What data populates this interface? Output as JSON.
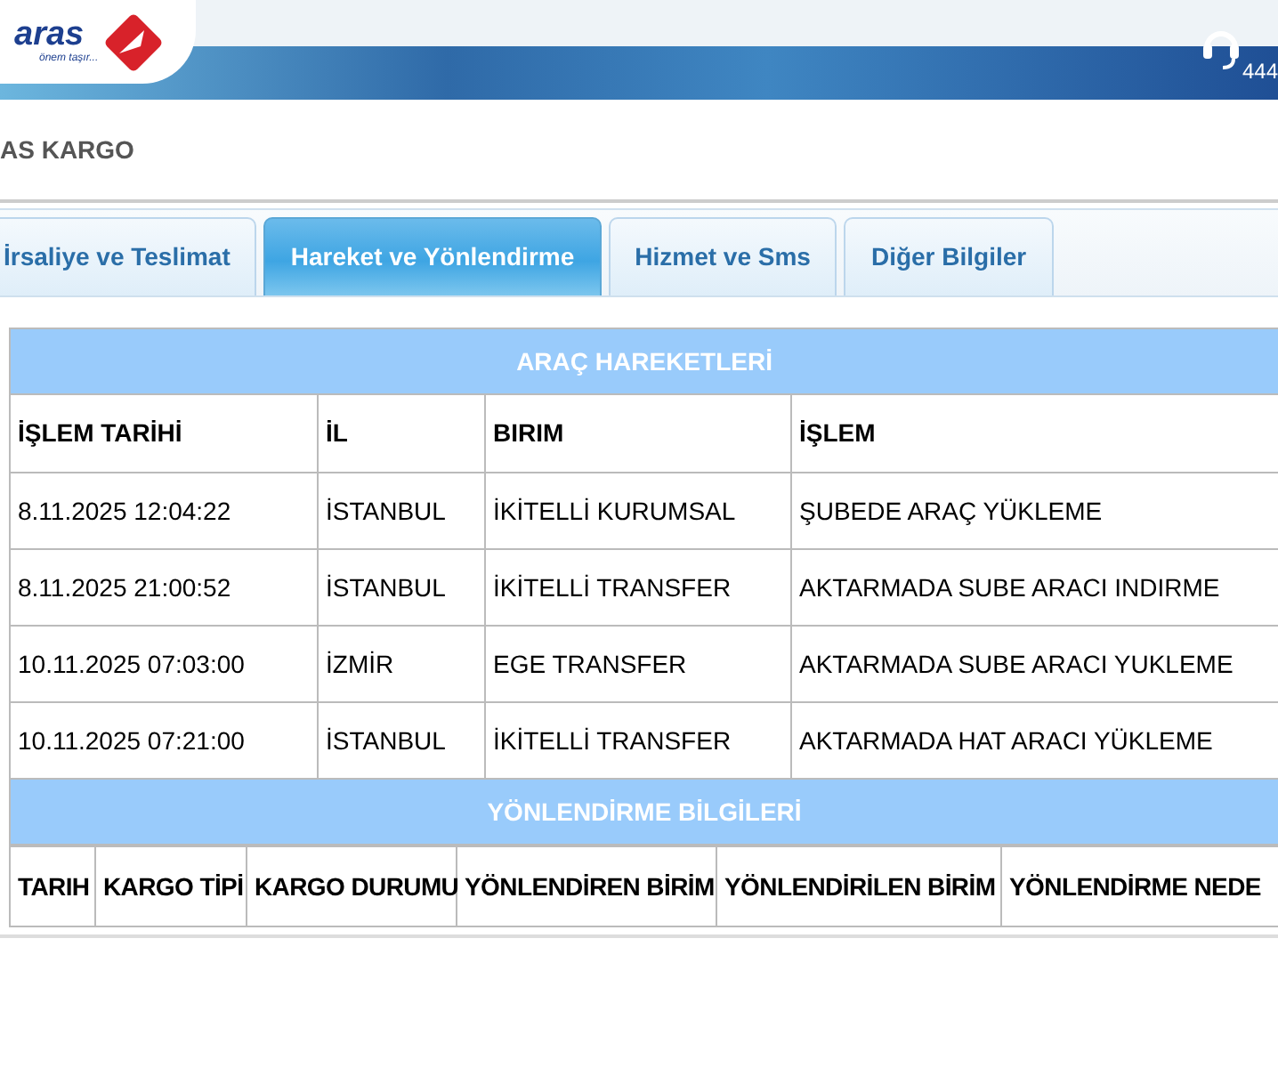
{
  "header": {
    "logo_text": "aras",
    "tagline": "önem taşır...",
    "phone": "444"
  },
  "company": "AS KARGO",
  "tabs": [
    {
      "label": "İrsaliye ve Teslimat",
      "selected": false
    },
    {
      "label": "Hareket ve Yönlendirme",
      "selected": true
    },
    {
      "label": "Hizmet ve Sms",
      "selected": false
    },
    {
      "label": "Diğer Bilgiler",
      "selected": false
    }
  ],
  "vehicle_movements": {
    "title": "ARAÇ HAREKETLERİ",
    "columns": [
      "İŞLEM TARİHİ",
      "İL",
      "BIRIM",
      "İŞLEM"
    ],
    "rows": [
      [
        "8.11.2025 12:04:22",
        "İSTANBUL",
        "İKİTELLİ KURUMSAL",
        "ŞUBEDE ARAÇ YÜKLEME"
      ],
      [
        "8.11.2025 21:00:52",
        "İSTANBUL",
        "İKİTELLİ TRANSFER",
        "AKTARMADA SUBE ARACI INDIRME"
      ],
      [
        "10.11.2025 07:03:00",
        "İZMİR",
        "EGE TRANSFER",
        "AKTARMADA SUBE ARACI YUKLEME"
      ],
      [
        "10.11.2025 07:21:00",
        "İSTANBUL",
        "İKİTELLİ TRANSFER",
        "AKTARMADA HAT ARACI YÜKLEME"
      ]
    ]
  },
  "routing_info": {
    "title": "YÖNLENDİRME BİLGİLERİ",
    "columns": [
      "TARIH",
      "KARGO TİPİ",
      "KARGO DURUMU",
      "YÖNLENDİREN BİRİM",
      "YÖNLENDİRİLEN BİRİM",
      "YÖNLENDİRME NEDE"
    ]
  }
}
